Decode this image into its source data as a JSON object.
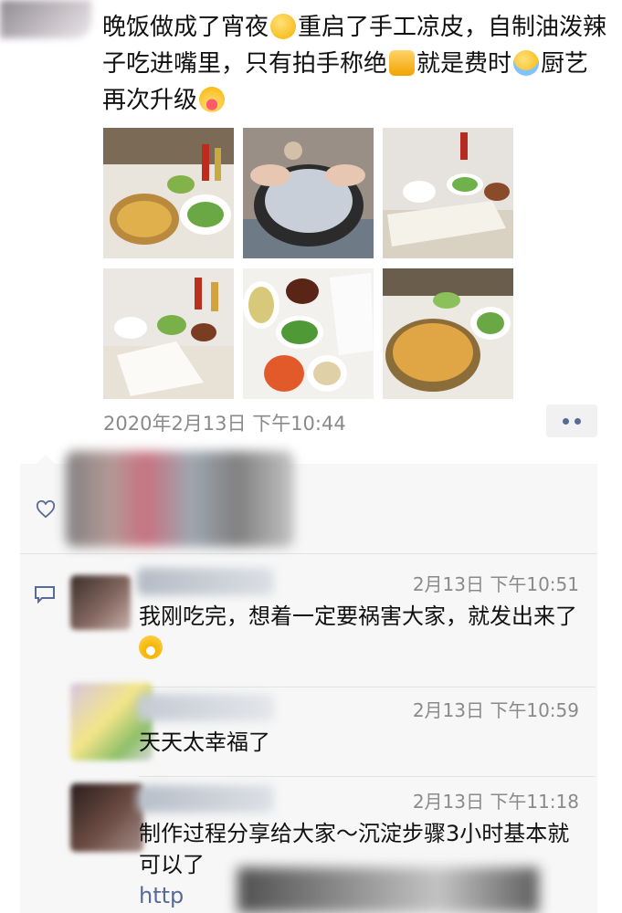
{
  "post": {
    "text_1": "晚饭做成了宵夜",
    "text_2": "重启了手工凉皮，自制油泼辣子吃进嘴里，只有拍手称绝",
    "text_3": "就是费时",
    "text_4": "厨艺再次升级",
    "timestamp": "2020年2月13日 下午10:44"
  },
  "colors": {
    "link": "#576b95",
    "meta": "#8a8a8a",
    "comment_bg": "#f7f7f7"
  },
  "comments": [
    {
      "time": "2月13日 下午10:51",
      "text": "我刚吃完，想着一定要祸害大家，就发出来了"
    },
    {
      "time": "2月13日 下午10:59",
      "text": "天天太幸福了"
    },
    {
      "time": "2月13日 下午11:18",
      "text": "制作过程分享给大家～沉淀步骤3小时基本就可以了",
      "link": "http"
    }
  ]
}
